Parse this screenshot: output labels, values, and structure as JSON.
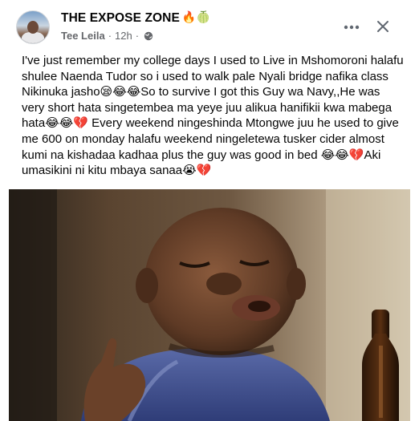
{
  "post": {
    "page_name": "THE EXPOSE ZONE",
    "page_name_emojis": "🔥🍈",
    "author": "Tee Leila",
    "timestamp": "12h",
    "separator": "·",
    "text": "I've just remember my college days I used to Live in Mshomoroni halafu shulee Naenda Tudor so i used to walk pale Nyali bridge nafika class Nikinuka jasho😪😂😂So to survive I got this Guy wa Navy,,He was very short hata singetembea ma yeye juu alikua hanifikii kwa mabega hata😂😂💔 Every weekend ningeshinda Mtongwe juu he used to give me 600 on monday halafu weekend ningeletewa tusker cider almost kumi na kishadaa kadhaa plus the guy was good in bed 😂😂💔Aki umasikini ni kitu mbaya sanaa😭💔"
  },
  "icons": {
    "privacy": "globe-icon",
    "more": "more-options-icon",
    "close": "close-icon"
  },
  "colors": {
    "secondary_text": "#65676b",
    "icon": "#606770"
  }
}
